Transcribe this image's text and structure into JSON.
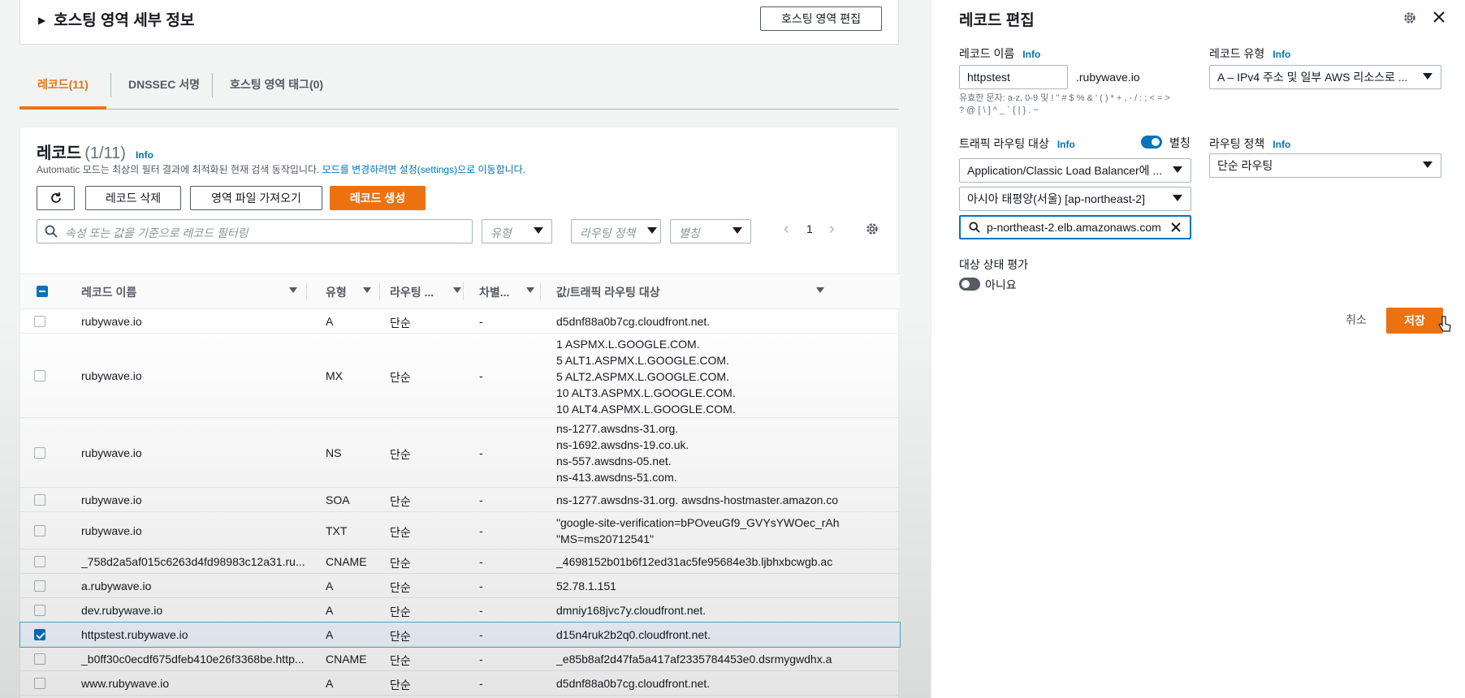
{
  "hosted_zone": {
    "details_title": "호스팅 영역 세부 정보",
    "edit_button": "호스팅 영역 편집"
  },
  "tabs": [
    {
      "label": "레코드(11)",
      "active": true
    },
    {
      "label": "DNSSEC 서명",
      "active": false
    },
    {
      "label": "호스팅 영역 태그(0)",
      "active": false
    }
  ],
  "records": {
    "title": "레코드",
    "count": "(1/11)",
    "info": "Info",
    "description": "Automatic 모드는 최상의 필터 결과에 최적화된 현재 검색 동작입니다.",
    "description_link": "모드를 변경하려면 설정(settings)으로 이동합니다.",
    "delete_button": "레코드 삭제",
    "import_button": "영역 파일 가져오기",
    "create_button": "레코드 생성",
    "search_placeholder": "속성 또는 값을 기준으로 레코드 필터링",
    "filter_type": "유형",
    "filter_routing": "라우팅 정책",
    "filter_alias": "별칭",
    "page": "1",
    "columns": [
      "레코드 이름",
      "유형",
      "라우팅 ...",
      "차별...",
      "값/트래픽 라우팅 대상"
    ],
    "rows": [
      {
        "name": "rubywave.io",
        "type": "A",
        "routing": "단순",
        "diff": "-",
        "value": [
          "d5dnf88a0b7cg.cloudfront.net."
        ],
        "checked": false
      },
      {
        "name": "rubywave.io",
        "type": "MX",
        "routing": "단순",
        "diff": "-",
        "value": [
          "1 ASPMX.L.GOOGLE.COM.",
          "5 ALT1.ASPMX.L.GOOGLE.COM.",
          "5 ALT2.ASPMX.L.GOOGLE.COM.",
          "10 ALT3.ASPMX.L.GOOGLE.COM.",
          "10 ALT4.ASPMX.L.GOOGLE.COM."
        ],
        "checked": false
      },
      {
        "name": "rubywave.io",
        "type": "NS",
        "routing": "단순",
        "diff": "-",
        "value": [
          "ns-1277.awsdns-31.org.",
          "ns-1692.awsdns-19.co.uk.",
          "ns-557.awsdns-05.net.",
          "ns-413.awsdns-51.com."
        ],
        "checked": false
      },
      {
        "name": "rubywave.io",
        "type": "SOA",
        "routing": "단순",
        "diff": "-",
        "value": [
          "ns-1277.awsdns-31.org. awsdns-hostmaster.amazon.co"
        ],
        "checked": false
      },
      {
        "name": "rubywave.io",
        "type": "TXT",
        "routing": "단순",
        "diff": "-",
        "value": [
          "\"google-site-verification=bPOveuGf9_GVYsYWOec_rAh",
          "\"MS=ms20712541\""
        ],
        "checked": false
      },
      {
        "name": "_758d2a5af015c6263d4fd98983c12a31.ru...",
        "type": "CNAME",
        "routing": "단순",
        "diff": "-",
        "value": [
          "_4698152b01b6f12ed31ac5fe95684e3b.ljbhxbcwgb.ac"
        ],
        "checked": false
      },
      {
        "name": "a.rubywave.io",
        "type": "A",
        "routing": "단순",
        "diff": "-",
        "value": [
          "52.78.1.151"
        ],
        "checked": false
      },
      {
        "name": "dev.rubywave.io",
        "type": "A",
        "routing": "단순",
        "diff": "-",
        "value": [
          "dmniy168jvc7y.cloudfront.net."
        ],
        "checked": false
      },
      {
        "name": "httpstest.rubywave.io",
        "type": "A",
        "routing": "단순",
        "diff": "-",
        "value": [
          "d15n4ruk2b2q0.cloudfront.net."
        ],
        "checked": true
      },
      {
        "name": "_b0ff30c0ecdf675dfeb410e26f3368be.http...",
        "type": "CNAME",
        "routing": "단순",
        "diff": "-",
        "value": [
          "_e85b8af2d47fa5a417af2335784453e0.dsrmygwdhx.a"
        ],
        "checked": false
      },
      {
        "name": "www.rubywave.io",
        "type": "A",
        "routing": "단순",
        "diff": "-",
        "value": [
          "d5dnf88a0b7cg.cloudfront.net."
        ],
        "checked": false
      }
    ]
  },
  "edit_panel": {
    "title": "레코드 편집",
    "info": "Info",
    "record_name_label": "레코드 이름",
    "record_name_value": "httpstest",
    "record_name_suffix": ".rubywave.io",
    "record_name_help": "유효한 문자: a-z, 0-9 및 ! \" # $ % & ' ( ) * + , - / : ; < = > ? @ [ \\ ] ^ _ ` { | } . ~",
    "record_type_label": "레코드 유형",
    "record_type_value": "A – IPv4 주소 및 일부 AWS 리소스로 ...",
    "traffic_target_label": "트래픽 라우팅 대상",
    "alias_label": "별칭",
    "alias_on": true,
    "target_type_value": "Application/Classic Load Balancer에 ...",
    "region_value": "아시아 태평양(서울) [ap-northeast-2]",
    "endpoint_value": "p-northeast-2.elb.amazonaws.com",
    "routing_policy_label": "라우팅 정책",
    "routing_policy_value": "단순 라우팅",
    "health_eval_label": "대상 상태 평가",
    "health_eval_value": "아니요",
    "health_eval_on": false,
    "cancel_button": "취소",
    "save_button": "저장"
  },
  "colors": {
    "accent": "#ec7211",
    "link": "#0073bb"
  }
}
